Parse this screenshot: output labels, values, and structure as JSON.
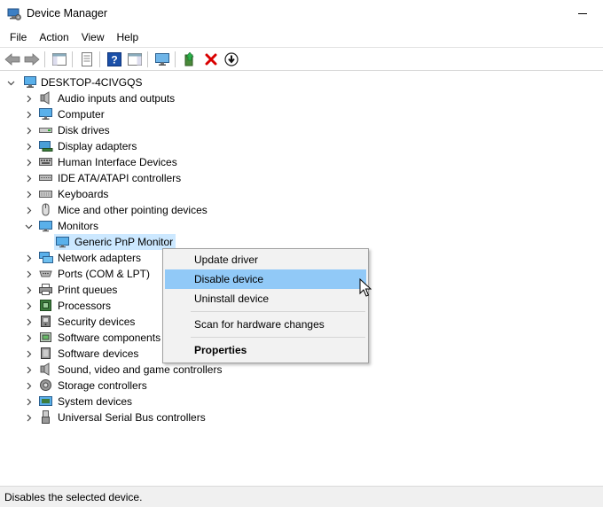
{
  "window": {
    "title": "Device Manager"
  },
  "menu": [
    "File",
    "Action",
    "View",
    "Help"
  ],
  "tree": {
    "root": "DESKTOP-4CIVGQS",
    "categories": [
      {
        "label": "Audio inputs and outputs",
        "icon": "speaker-icon"
      },
      {
        "label": "Computer",
        "icon": "computer-icon"
      },
      {
        "label": "Disk drives",
        "icon": "disk-drive-icon"
      },
      {
        "label": "Display adapters",
        "icon": "display-adapter-icon"
      },
      {
        "label": "Human Interface Devices",
        "icon": "hid-icon"
      },
      {
        "label": "IDE ATA/ATAPI controllers",
        "icon": "ide-controller-icon"
      },
      {
        "label": "Keyboards",
        "icon": "keyboard-icon"
      },
      {
        "label": "Mice and other pointing devices",
        "icon": "mouse-icon"
      },
      {
        "label": "Monitors",
        "icon": "monitor-icon",
        "expanded": true
      },
      {
        "label": "Network adapters",
        "icon": "network-adapter-icon"
      },
      {
        "label": "Ports (COM & LPT)",
        "icon": "port-icon"
      },
      {
        "label": "Print queues",
        "icon": "printer-icon"
      },
      {
        "label": "Processors",
        "icon": "processor-icon"
      },
      {
        "label": "Security devices",
        "icon": "security-device-icon"
      },
      {
        "label": "Software components",
        "icon": "software-component-icon"
      },
      {
        "label": "Software devices",
        "icon": "software-device-icon"
      },
      {
        "label": "Sound, video and game controllers",
        "icon": "sound-controller-icon"
      },
      {
        "label": "Storage controllers",
        "icon": "storage-controller-icon"
      },
      {
        "label": "System devices",
        "icon": "system-device-icon"
      },
      {
        "label": "Universal Serial Bus controllers",
        "icon": "usb-controller-icon"
      }
    ],
    "monitor_child": "Generic PnP Monitor"
  },
  "context_menu": {
    "update": "Update driver",
    "disable": "Disable device",
    "uninstall": "Uninstall device",
    "scan": "Scan for hardware changes",
    "properties": "Properties",
    "highlighted": "Disable device"
  },
  "status": {
    "text": "Disables the selected device."
  },
  "colors": {
    "selection": "#cce8ff",
    "menu_highlight": "#91c9f7",
    "menu_background": "#f2f2f2",
    "delete_red": "#d90000",
    "help_blue": "#1a4fa8"
  }
}
